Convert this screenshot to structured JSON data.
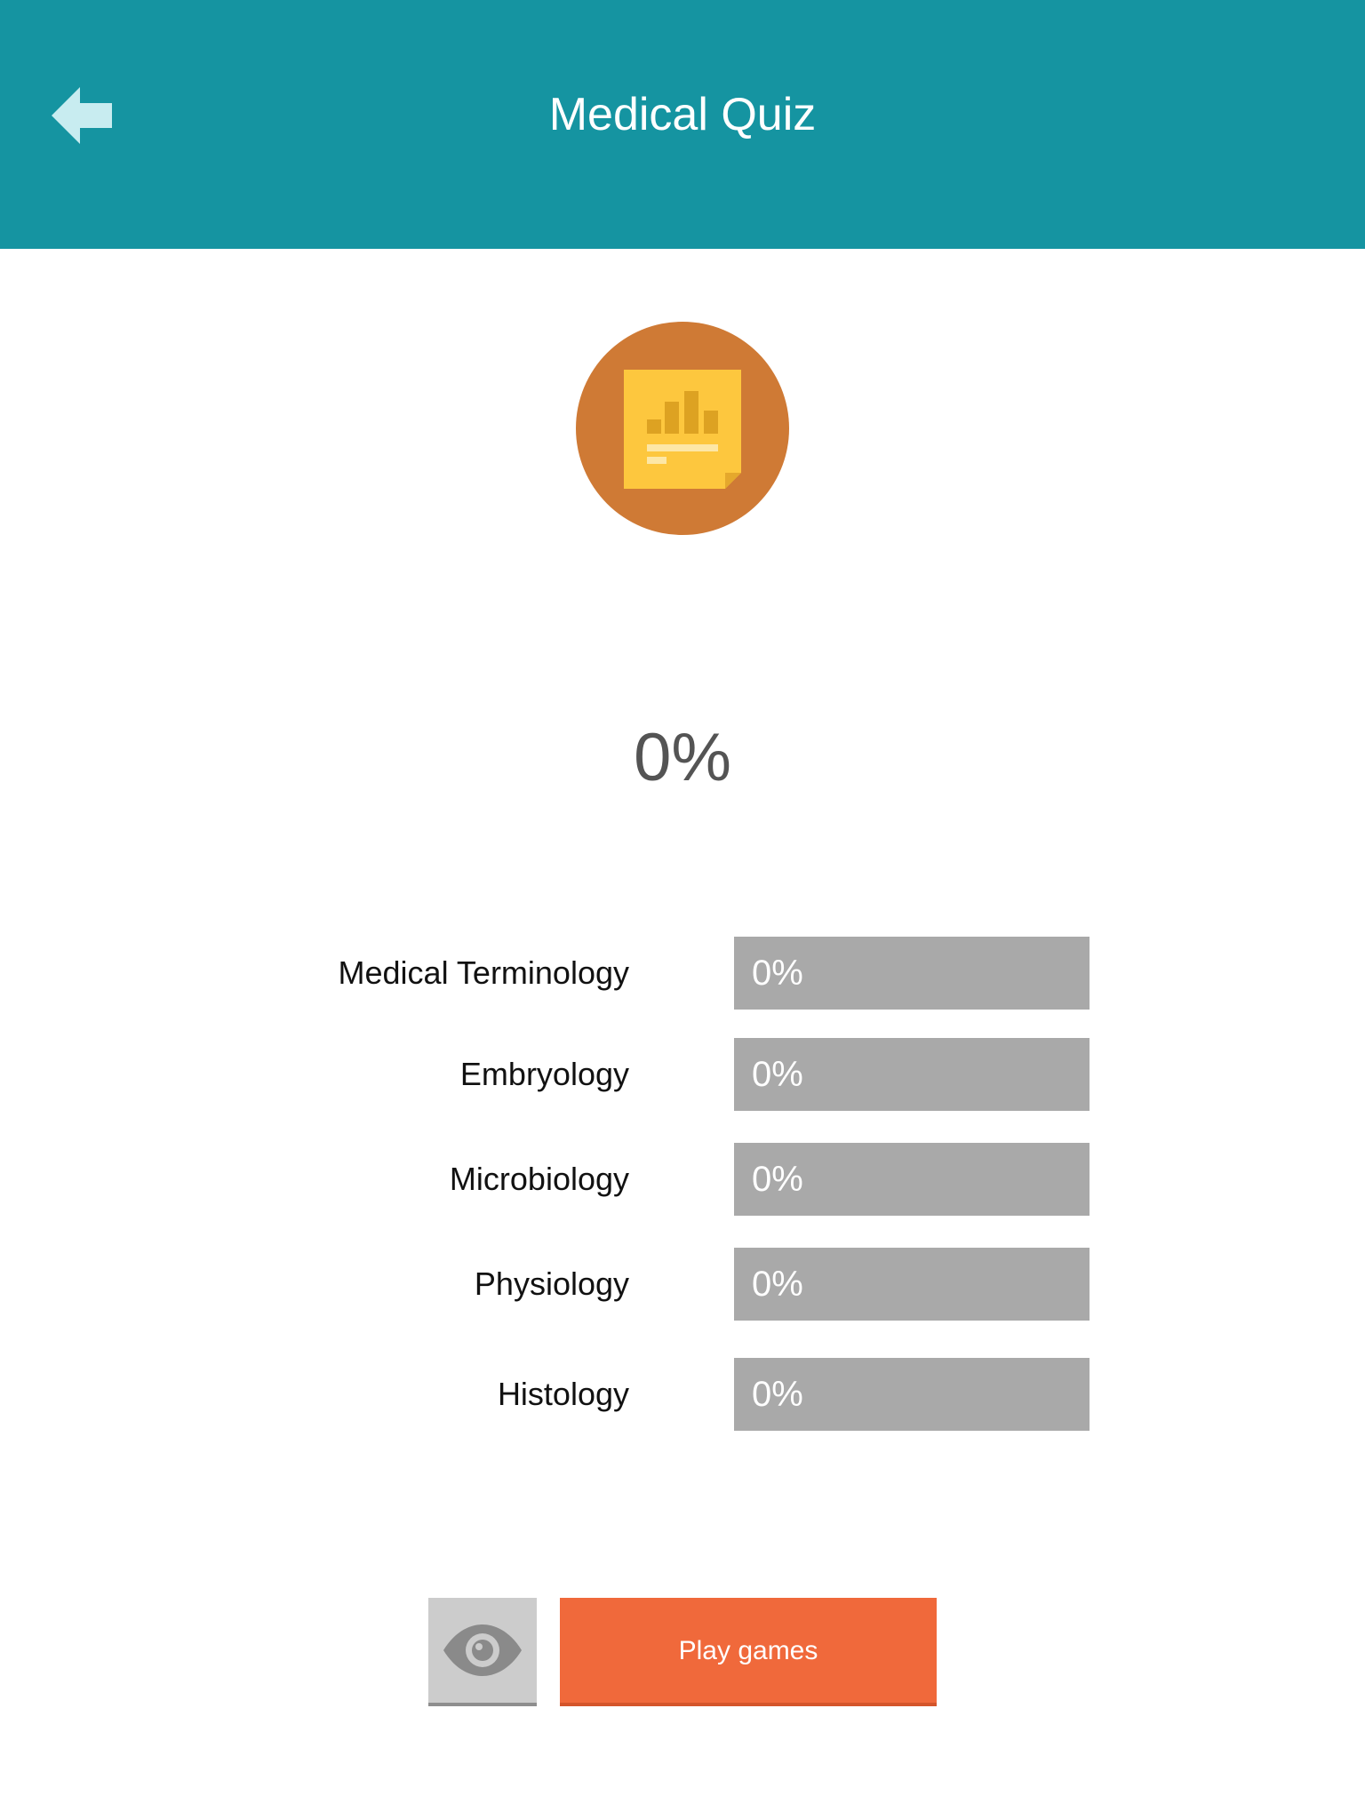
{
  "header": {
    "title": "Medical Quiz",
    "back_icon": "back-arrow-icon",
    "background_color": "#1594a1"
  },
  "summary": {
    "icon": "stats-note-icon",
    "total_percent": "0%",
    "total_progress": 0
  },
  "categories": [
    {
      "label": "Medical Terminology",
      "percent": "0%",
      "progress": 0
    },
    {
      "label": "Embryology",
      "percent": "0%",
      "progress": 0
    },
    {
      "label": "Microbiology",
      "percent": "0%",
      "progress": 0
    },
    {
      "label": "Physiology",
      "percent": "0%",
      "progress": 0
    },
    {
      "label": "Histology",
      "percent": "0%",
      "progress": 0
    }
  ],
  "actions": {
    "review_icon": "eye-icon",
    "play_label": "Play games",
    "play_color": "#f0693b"
  }
}
